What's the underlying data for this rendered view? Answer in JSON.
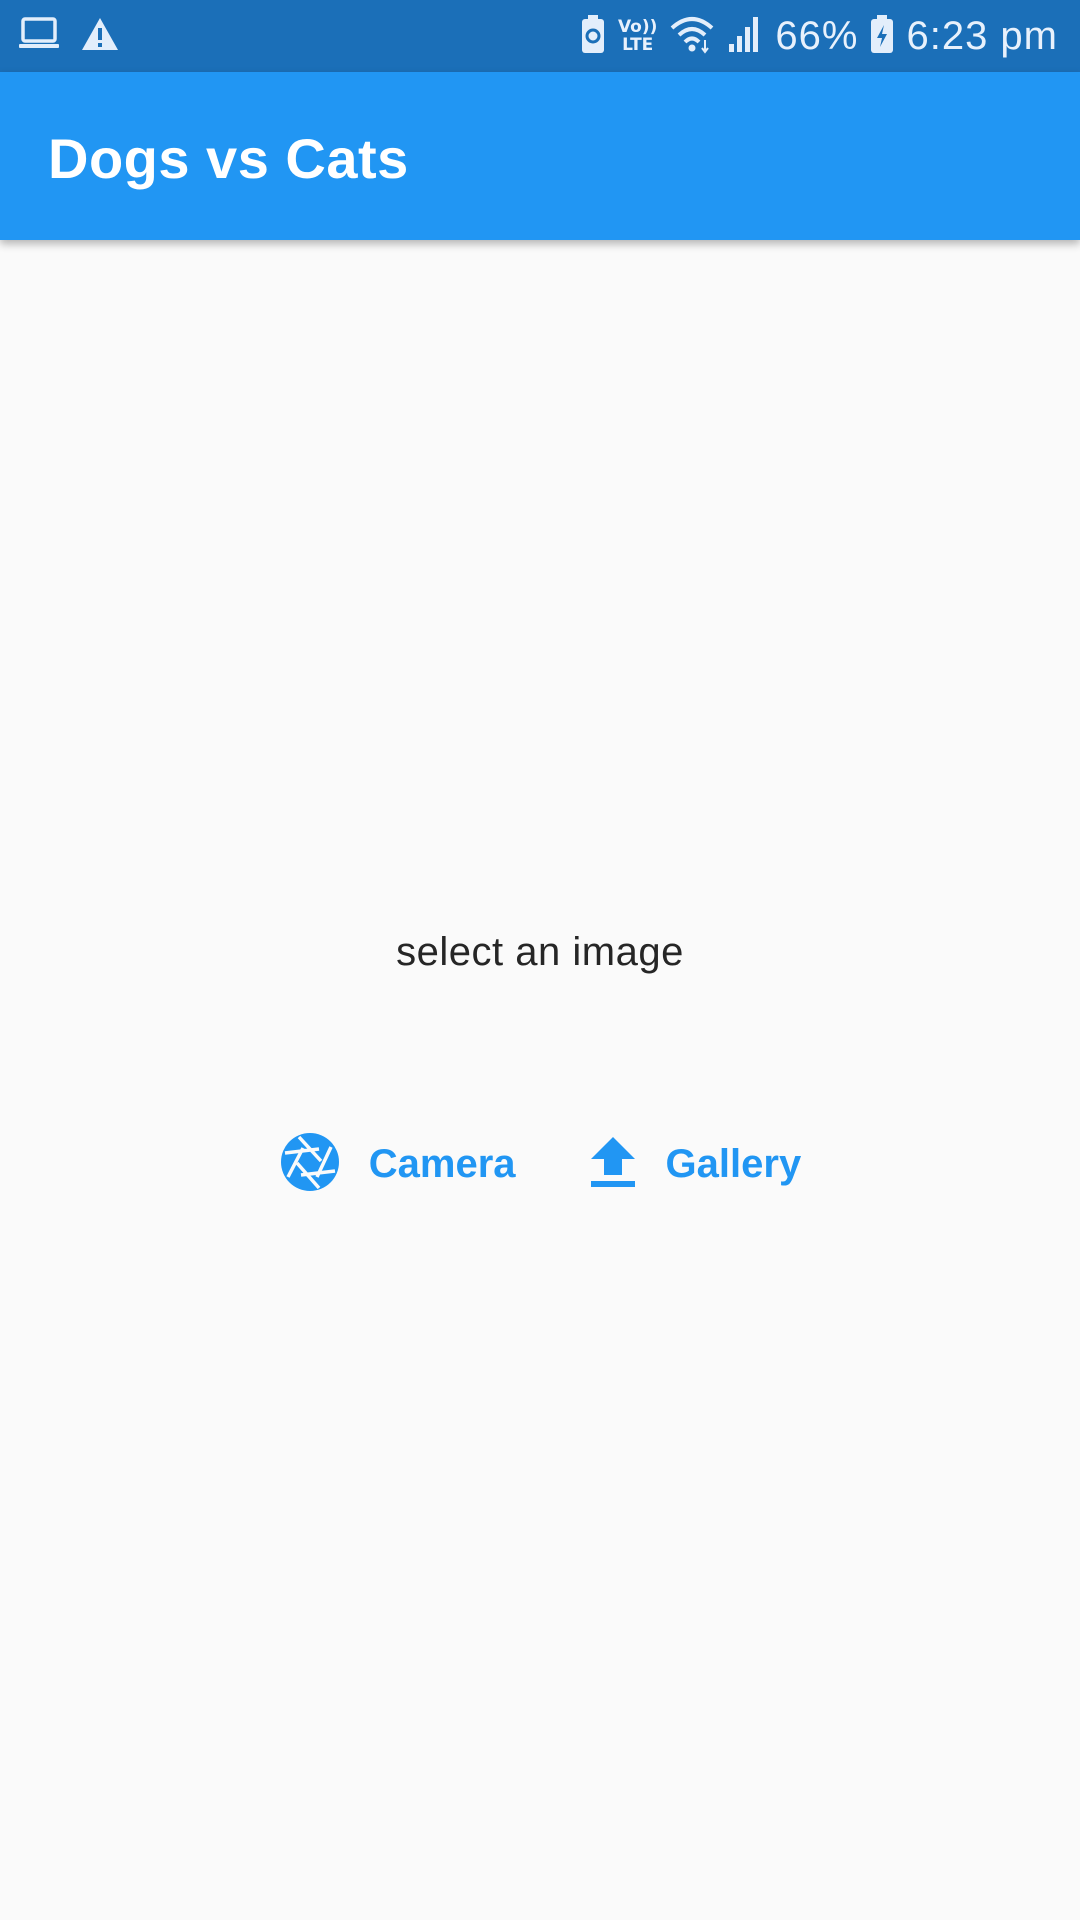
{
  "status_bar": {
    "left_icons": [
      "laptop-icon",
      "warning-icon"
    ],
    "right_icons": [
      "battery-saver-icon",
      "volte-icon",
      "wifi-icon",
      "signal-icon",
      "battery-icon"
    ],
    "volte_top": "Vo))",
    "volte_bottom": "LTE",
    "battery_percent": "66%",
    "time": "6:23 pm"
  },
  "app_bar": {
    "title": "Dogs vs Cats",
    "color": "#2196f3"
  },
  "main": {
    "prompt": "select an image",
    "actions": [
      {
        "label": "Camera",
        "icon": "camera-shutter-icon"
      },
      {
        "label": "Gallery",
        "icon": "upload-icon"
      }
    ],
    "accent_color": "#2196f3"
  }
}
